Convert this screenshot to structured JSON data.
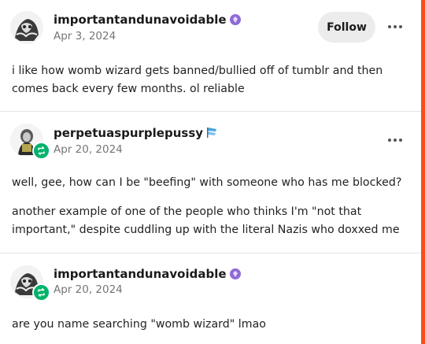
{
  "posts": [
    {
      "username": "importantandunavoidable",
      "badge_icon": "purple-gem-badge-icon",
      "date": "Apr 3, 2024",
      "follow_label": "Follow",
      "paragraphs": [
        "i like how womb wizard gets banned/bullied off of tumblr and then comes back every few months. ol reliable"
      ]
    },
    {
      "username": "perpetuaspurplepussy",
      "badge_icon": "blue-pennant-badge-icon",
      "date": "Apr 20, 2024",
      "reblog": true,
      "paragraphs": [
        "well, gee, how can I be \"beefing\" with someone who has me blocked?",
        "another example of one of the people who thinks I'm \"not that important,\" despite cuddling up with the literal Nazis who doxxed me"
      ]
    },
    {
      "username": "importantandunavoidable",
      "badge_icon": "purple-gem-badge-icon",
      "date": "Apr 20, 2024",
      "reblog": true,
      "paragraphs": [
        "are you name searching \"womb wizard\" lmao"
      ]
    }
  ],
  "colors": {
    "accent": "#ff4c16",
    "reblog_green": "#00b36b",
    "date_gray": "#767676",
    "follow_bg": "#ececec"
  }
}
